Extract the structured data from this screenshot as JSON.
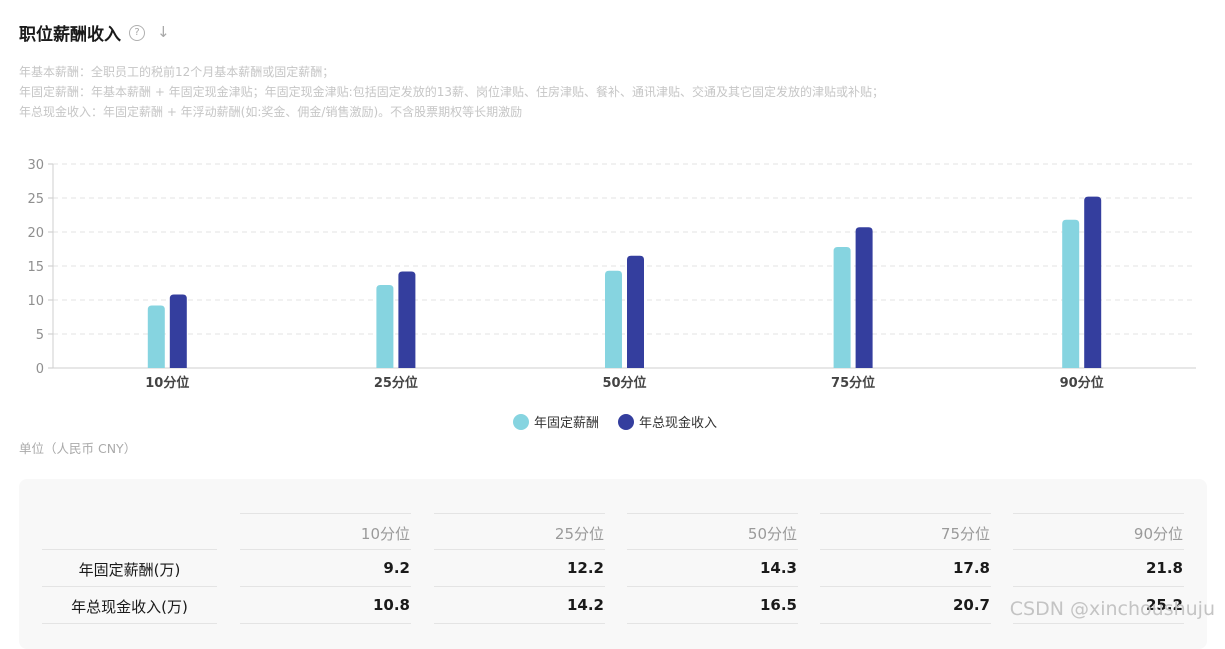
{
  "header": {
    "title": "职位薪酬收入",
    "help_glyph": "?",
    "download_glyph": "↓"
  },
  "notes": [
    "年基本薪酬：全职员工的税前12个月基本薪酬或固定薪酬；",
    "年固定薪酬：年基本薪酬 + 年固定现金津贴；年固定现金津贴:包括固定发放的13薪、岗位津贴、住房津贴、餐补、通讯津贴、交通及其它固定发放的津贴或补贴；",
    "年总现金收入：年固定薪酬 + 年浮动薪酬(如:奖金、佣金/销售激励)。不含股票期权等长期激励"
  ],
  "unit_label": "单位（人民币 CNY）",
  "chart_data": {
    "type": "bar",
    "categories": [
      "10分位",
      "25分位",
      "50分位",
      "75分位",
      "90分位"
    ],
    "series": [
      {
        "name": "年固定薪酬",
        "values": [
          9.2,
          12.2,
          14.3,
          17.8,
          21.8
        ],
        "color": "#86d4e0"
      },
      {
        "name": "年总现金收入",
        "values": [
          10.8,
          14.2,
          16.5,
          20.7,
          25.2
        ],
        "color": "#343e9e"
      }
    ],
    "ylim": [
      0,
      30
    ],
    "yticks": [
      0,
      5,
      10,
      15,
      20,
      25,
      30
    ],
    "grid": true,
    "legend_position": "bottom-center"
  },
  "table": {
    "columns": [
      "10分位",
      "25分位",
      "50分位",
      "75分位",
      "90分位"
    ],
    "rows": [
      {
        "label": "年固定薪酬(万)",
        "values": [
          "9.2",
          "12.2",
          "14.3",
          "17.8",
          "21.8"
        ]
      },
      {
        "label": "年总现金收入(万)",
        "values": [
          "10.8",
          "14.2",
          "16.5",
          "20.7",
          "25.2"
        ]
      }
    ]
  },
  "watermark": "CSDN @xinchoushuju"
}
